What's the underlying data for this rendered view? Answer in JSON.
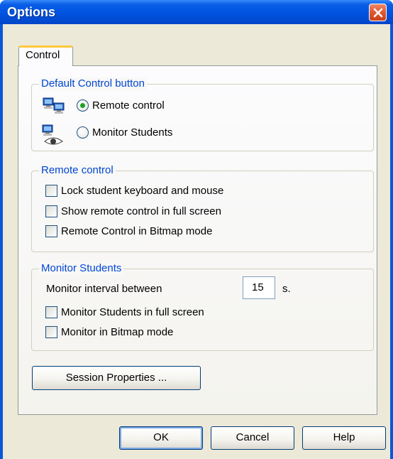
{
  "window": {
    "title": "Options"
  },
  "tabs": [
    {
      "label": "Control",
      "selected": true
    }
  ],
  "default_control_group": {
    "title": "Default Control button",
    "options": [
      {
        "label": "Remote control",
        "checked": true,
        "icon": "remote-control-icon"
      },
      {
        "label": "Monitor Students",
        "checked": false,
        "icon": "monitor-eye-icon"
      }
    ]
  },
  "remote_control_group": {
    "title": "Remote control",
    "options": [
      {
        "label": "Lock student keyboard and mouse",
        "checked": false
      },
      {
        "label": "Show remote control in full screen",
        "checked": false
      },
      {
        "label": "Remote Control in Bitmap mode",
        "checked": false
      }
    ]
  },
  "monitor_group": {
    "title": "Monitor Students",
    "interval_label": "Monitor interval between",
    "interval_value": "15",
    "interval_unit": "s.",
    "options": [
      {
        "label": "Monitor Students in full screen",
        "checked": false
      },
      {
        "label": "Monitor in Bitmap mode",
        "checked": false
      }
    ]
  },
  "session_button": "Session Properties ...",
  "footer": {
    "ok": "OK",
    "cancel": "Cancel",
    "help": "Help"
  },
  "colors": {
    "title_bar": "#0054e3",
    "group_title": "#0046d5",
    "face": "#ece9d8",
    "radio_dot": "#21a121"
  }
}
